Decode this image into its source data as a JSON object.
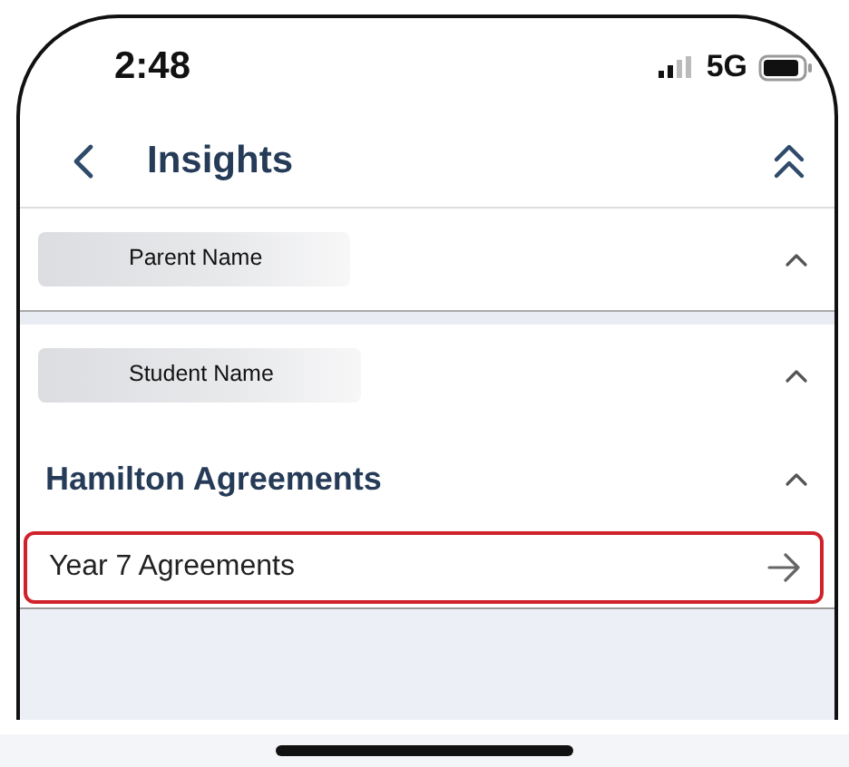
{
  "status_bar": {
    "time": "2:48",
    "network": "5G"
  },
  "nav": {
    "title": "Insights"
  },
  "sections": [
    {
      "kind": "pill",
      "label": "Parent Name",
      "expanded": true
    },
    {
      "kind": "pill",
      "label": "Student Name",
      "expanded": true
    },
    {
      "kind": "heading",
      "label": "Hamilton Agreements",
      "expanded": true,
      "items": [
        {
          "label": "Year 7 Agreements",
          "highlighted": true
        }
      ]
    }
  ]
}
